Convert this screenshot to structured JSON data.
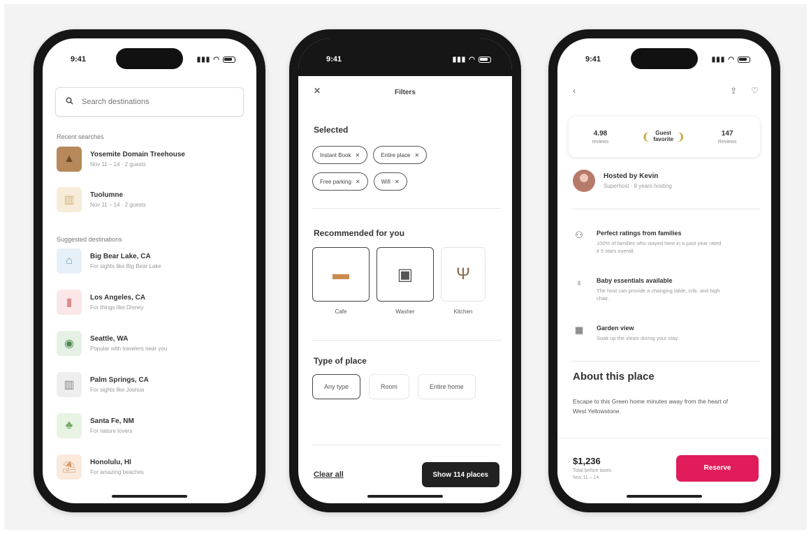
{
  "phone1": {
    "time": "9:41",
    "search_placeholder": "Search destinations",
    "recent_label": "Recent searches",
    "recent": [
      {
        "title": "Yosemite Domain Treehouse",
        "sub": "Nov 11 – 14 · 2 guests",
        "icon": "cabin-photo",
        "bg": "#b7895a",
        "glyph": "▲"
      },
      {
        "title": "Tuolumne",
        "sub": "Nov 11 – 14 · 2 guests",
        "icon": "building-icon",
        "bg": "#f6ecd9",
        "glyph": "▥"
      }
    ],
    "suggested_label": "Suggested destinations",
    "suggested": [
      {
        "title": "Big Bear Lake, CA",
        "sub": "For sights like Big Bear Lake",
        "icon": "house-icon",
        "bg": "#e6f0f8",
        "glyph": "⌂"
      },
      {
        "title": "Los Angeles, CA",
        "sub": "For things like Disney",
        "icon": "chart-icon",
        "bg": "#fbe7e7",
        "glyph": "▮"
      },
      {
        "title": "Seattle, WA",
        "sub": "Popular with travelers near you",
        "icon": "map-icon",
        "bg": "#e4f1e4",
        "glyph": "◉"
      },
      {
        "title": "Palm Springs, CA",
        "sub": "For sights like Joshua",
        "icon": "city-icon",
        "bg": "#eeeeee",
        "glyph": "▥"
      },
      {
        "title": "Santa Fe, NM",
        "sub": "For nature lovers",
        "icon": "landmark-icon",
        "bg": "#e8f3e3",
        "glyph": "♣"
      },
      {
        "title": "Honolulu, HI",
        "sub": "For amazing beaches",
        "icon": "beach-icon",
        "bg": "#fbe9dc",
        "glyph": "⛱"
      }
    ]
  },
  "phone2": {
    "time": "9:41",
    "title": "Filters",
    "selected_label": "Selected",
    "chips": [
      "Instant Book",
      "Entire place",
      "Free parking",
      "Wifi"
    ],
    "recommended_label": "Recommended for you",
    "recommended": [
      {
        "label": "Cafe",
        "icon": "sofa-icon",
        "glyph": "🛋"
      },
      {
        "label": "Washer",
        "icon": "washer-icon",
        "glyph": "▣"
      },
      {
        "label": "Kitchen",
        "icon": "utensils-icon",
        "glyph": "🍴"
      }
    ],
    "type_label": "Type of place",
    "types": [
      "Any type",
      "Room",
      "Entire home"
    ],
    "clear_label": "Clear all",
    "show_label": "Show 114 places"
  },
  "phone3": {
    "time": "9:41",
    "stats": {
      "reviews_value": "4.98",
      "reviews_label": "reviews",
      "badge_line1": "Guest",
      "badge_line2": "favorite",
      "count_value": "147",
      "count_label": "Reviews"
    },
    "host_title": "Hosted by Kevin",
    "host_sub": "Superhost · 8 years hosting",
    "features": [
      {
        "icon": "family-icon",
        "glyph": "⚇",
        "title": "Perfect ratings from families",
        "desc": "100% of families who stayed here in a past year rated it 5 stars overall."
      },
      {
        "icon": "baby-icon",
        "glyph": "♁",
        "title": "Baby essentials available",
        "desc": "The host can provide a changing table, crib, and high chair."
      },
      {
        "icon": "calendar-icon",
        "glyph": "▦",
        "title": "Garden view",
        "desc": "Soak up the views during your stay."
      }
    ],
    "about_title": "About this place",
    "about_body": "Escape to this Green home minutes away from the heart of West Yellowstone.",
    "price": "$1,236",
    "price_sub1": "Total before taxes",
    "price_sub2": "Nov 11 – 14",
    "reserve_label": "Reserve"
  },
  "colors": {
    "accent": "#e01d5a",
    "dark": "#222222",
    "gold": "#c9a227"
  }
}
